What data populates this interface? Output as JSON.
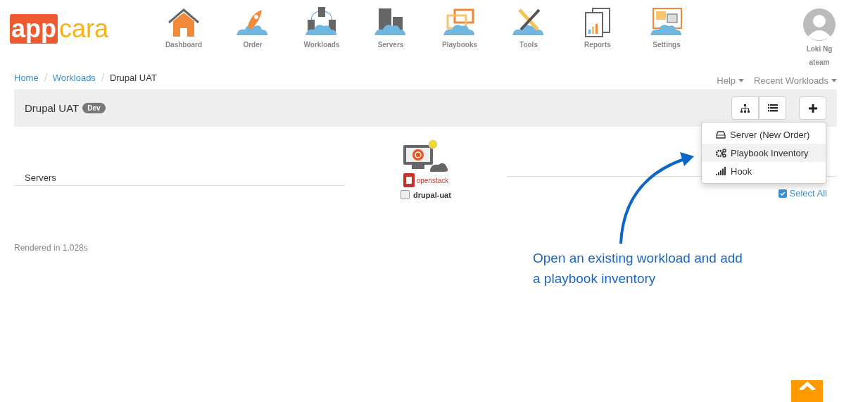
{
  "logo": {
    "part_1": "app",
    "part_2": "cara"
  },
  "nav": [
    {
      "kind": "house",
      "label": "Dashboard"
    },
    {
      "kind": "rocket",
      "label": "Order"
    },
    {
      "kind": "workloads",
      "label": "Workloads"
    },
    {
      "kind": "servers",
      "label": "Servers"
    },
    {
      "kind": "playbooks",
      "label": "Playbooks"
    },
    {
      "kind": "tools",
      "label": "Tools"
    },
    {
      "kind": "reports",
      "label": "Reports"
    },
    {
      "kind": "settings",
      "label": "Settings"
    }
  ],
  "user": {
    "name": "Loki Ng",
    "team": "ateam"
  },
  "breadcrumb": [
    "Home",
    "Workloads",
    "Drupal UAT"
  ],
  "top_links": [
    "Help",
    "Recent Workloads"
  ],
  "workload": {
    "title": "Drupal UAT",
    "badge": "Dev"
  },
  "add_menu": [
    {
      "kind": "server",
      "label": "Server (New Order)",
      "selected": false
    },
    {
      "kind": "gears",
      "label": "Playbook Inventory",
      "selected": true
    },
    {
      "kind": "signal",
      "label": "Hook",
      "selected": false
    }
  ],
  "servers": {
    "heading": "Servers",
    "select_all": "Select All",
    "nodes": [
      {
        "name": "drupal-uat",
        "cloud": "openstack",
        "checked": false
      }
    ]
  },
  "footer": "Rendered in 1.028s",
  "annotation": "Open an existing workload and add a playbook inventory"
}
